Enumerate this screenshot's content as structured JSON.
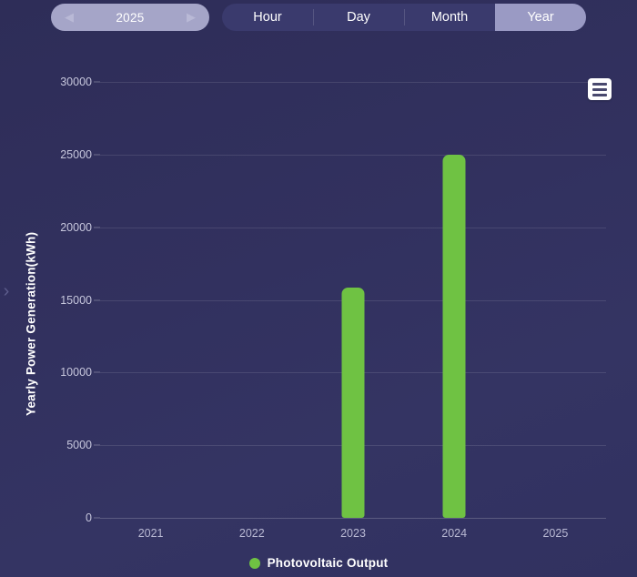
{
  "topbar": {
    "year_picker": {
      "value": "2025",
      "prev_icon": "◀",
      "next_icon": "▶"
    },
    "range_tabs": [
      {
        "label": "Hour",
        "active": false
      },
      {
        "label": "Day",
        "active": false
      },
      {
        "label": "Month",
        "active": false
      },
      {
        "label": "Year",
        "active": true
      }
    ]
  },
  "edge_toggle": {
    "icon": "›"
  },
  "menu_button": {
    "icon": "hamburger-menu-icon"
  },
  "legend": {
    "label": "Photovoltaic Output",
    "color": "#6fc243"
  },
  "colors": {
    "background": "#32315f",
    "bar": "#6fc243",
    "tab_active": "#9a9ac4",
    "tab_bar": "#3a3a6d",
    "year_picker": "#a5a5c8",
    "gridline": "rgba(255,255,255,0.11)",
    "tick_text": "#c7c7dd"
  },
  "chart_data": {
    "type": "bar",
    "title": "",
    "xlabel": "",
    "ylabel": "Yearly Power Generation(kWh)",
    "categories": [
      "2021",
      "2022",
      "2023",
      "2024",
      "2025"
    ],
    "series": [
      {
        "name": "Photovoltaic Output",
        "color": "#6fc243",
        "values": [
          0,
          0,
          15845,
          24990,
          0
        ]
      }
    ],
    "ylim": [
      0,
      30000
    ],
    "yticks": [
      0,
      5000,
      10000,
      15000,
      20000,
      25000,
      30000
    ],
    "ytick_labels": [
      "0",
      "5000",
      "10000",
      "15000",
      "20000",
      "25000",
      "30000"
    ],
    "grid": true,
    "legend_position": "bottom"
  }
}
